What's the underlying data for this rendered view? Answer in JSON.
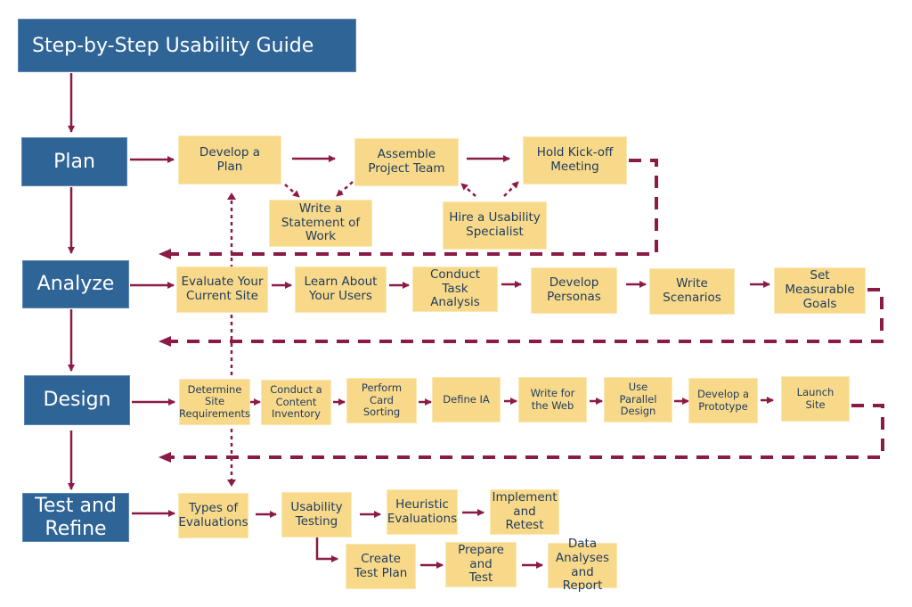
{
  "title": "Step-by-Step Usability Guide",
  "colors": {
    "phase": "#2f6496",
    "step": "#f8d98a",
    "arrow": "#8b1a46",
    "text_dark": "#1f3b5c"
  },
  "phases": [
    {
      "id": "plan",
      "label": "Plan"
    },
    {
      "id": "analyze",
      "label": "Analyze"
    },
    {
      "id": "design",
      "label": "Design"
    },
    {
      "id": "test",
      "label": "Test and\nRefine"
    }
  ],
  "plan_steps": [
    {
      "id": "develop-plan",
      "label": "Develop a\nPlan"
    },
    {
      "id": "assemble-team",
      "label": "Assemble\nProject Team"
    },
    {
      "id": "kickoff",
      "label": "Hold Kick-off\nMeeting"
    },
    {
      "id": "statement-of-work",
      "label": "Write a\nStatement of\nWork"
    },
    {
      "id": "hire-specialist",
      "label": "Hire a Usability\nSpecialist"
    }
  ],
  "analyze_steps": [
    {
      "id": "evaluate-site",
      "label": "Evaluate Your\nCurrent Site"
    },
    {
      "id": "learn-users",
      "label": "Learn About\nYour Users"
    },
    {
      "id": "task-analysis",
      "label": "Conduct Task\nAnalysis"
    },
    {
      "id": "personas",
      "label": "Develop\nPersonas"
    },
    {
      "id": "scenarios",
      "label": "Write\nScenarios"
    },
    {
      "id": "goals",
      "label": "Set\nMeasurable\nGoals"
    }
  ],
  "design_steps": [
    {
      "id": "site-requirements",
      "label": "Determine\nSite\nRequirements"
    },
    {
      "id": "content-inventory",
      "label": "Conduct a\nContent\nInventory"
    },
    {
      "id": "card-sorting",
      "label": "Perform\nCard\nSorting"
    },
    {
      "id": "define-ia",
      "label": "Define IA"
    },
    {
      "id": "write-web",
      "label": "Write for\nthe Web"
    },
    {
      "id": "parallel-design",
      "label": "Use\nParallel\nDesign"
    },
    {
      "id": "prototype",
      "label": "Develop a\nPrototype"
    },
    {
      "id": "launch",
      "label": "Launch\nSite"
    }
  ],
  "test_steps": [
    {
      "id": "types-evaluations",
      "label": "Types of\nEvaluations"
    },
    {
      "id": "usability-testing",
      "label": "Usability\nTesting"
    },
    {
      "id": "heuristic",
      "label": "Heuristic\nEvaluations"
    },
    {
      "id": "implement-retest",
      "label": "Implement\nand\nRetest"
    },
    {
      "id": "test-plan",
      "label": "Create\nTest Plan"
    },
    {
      "id": "prepare-test",
      "label": "Prepare\nand\nTest"
    },
    {
      "id": "data-analyses",
      "label": "Data\nAnalyses\nand Report"
    }
  ]
}
